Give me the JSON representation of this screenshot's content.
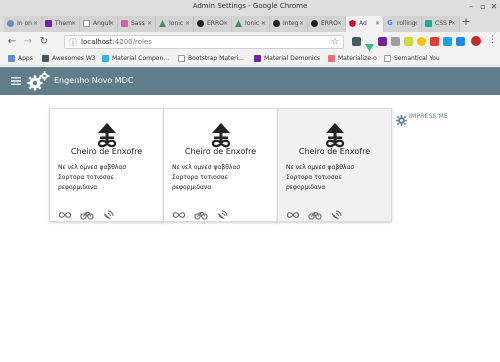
{
  "window": {
    "title": "Admin Settings - Google Chrome"
  },
  "tabs": [
    {
      "label": "In on",
      "icon": "chrome-icon",
      "color": "#5b8dd9"
    },
    {
      "label": "Them",
      "icon": "theme-icon",
      "color": "#7b1fa2"
    },
    {
      "label": "Angul",
      "icon": "page-icon",
      "color": "#9e9e9e"
    },
    {
      "label": "Sass",
      "icon": "sass-icon",
      "color": "#cd6799"
    },
    {
      "label": "Ionic",
      "icon": "ionic-icon",
      "color": "#3f8f63"
    },
    {
      "label": "ERRO",
      "icon": "github-icon",
      "color": "#222222"
    },
    {
      "label": "Ionic",
      "icon": "ionic-icon",
      "color": "#3f8f63"
    },
    {
      "label": "Integ",
      "icon": "github-icon",
      "color": "#222222"
    },
    {
      "label": "ERRO",
      "icon": "github-icon",
      "color": "#222222"
    },
    {
      "label": "Ad",
      "icon": "angular-icon",
      "color": "#dd0031",
      "active": true
    },
    {
      "label": "rolling",
      "icon": "google-icon",
      "color": "#4285f4"
    },
    {
      "label": "CSS P",
      "icon": "css-icon",
      "color": "#26a69a"
    }
  ],
  "toolbar": {
    "url_host": "localhost",
    "url_path": ":4200/roles"
  },
  "bookmarks": [
    {
      "label": "Apps",
      "icon": "apps-icon",
      "color": "#5b8dd9"
    },
    {
      "label": "Awesomes W3",
      "icon": "bookmark-icon",
      "color": "#455a64"
    },
    {
      "label": "Material Compon...",
      "icon": "bookmark-icon",
      "color": "#29b6f6"
    },
    {
      "label": "Bootstrap Materi...",
      "icon": "page-icon",
      "color": "#9e9e9e"
    },
    {
      "label": "Material Demonics",
      "icon": "bookmark-icon",
      "color": "#7b1fa2"
    },
    {
      "label": "Materialize-o",
      "icon": "bookmark-icon",
      "color": "#ee6e73"
    },
    {
      "label": "Semantical You",
      "icon": "page-icon",
      "color": "#9e9e9e"
    }
  ],
  "app": {
    "title": "Engenho Novo MDC",
    "bar_color": "#607d8b"
  },
  "cards": [
    {
      "title": "Cheiro de Enxofre",
      "lines": [
        "Νε νελ ομνεσ φαβθλασ",
        "Σορτορα τοτιοσαε",
        "ρεφορμιδανα"
      ],
      "shaded": false
    },
    {
      "title": "Cheiro de Enxofre",
      "lines": [
        "Νε νελ ομνεσ φαβθλασ",
        "Σορτορα τοτιοσαε",
        "ρεφορμιδανα"
      ],
      "shaded": false
    },
    {
      "title": "Cheiro de Enxofre",
      "lines": [
        "Νε νελ ομνεσ φαβθλασ",
        "Σορτορα τοτιοσαε",
        "ρεφορμιδανα"
      ],
      "shaded": true
    }
  ],
  "impress": {
    "label": "IMPRESS ME"
  }
}
